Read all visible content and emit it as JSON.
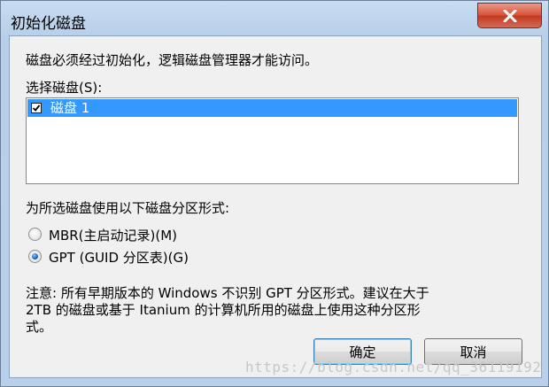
{
  "window": {
    "title": "初始化磁盘",
    "close_icon": "close-icon"
  },
  "dialog": {
    "description": "磁盘必须经过初始化，逻辑磁盘管理器才能访问。",
    "select_label": "选择磁盘(S):",
    "disks": [
      {
        "label": "磁盘 1",
        "checked": true,
        "selected": true
      }
    ],
    "partition_label": "为所选磁盘使用以下磁盘分区形式:",
    "options": [
      {
        "label": "MBR(主启动记录)(M)",
        "selected": false
      },
      {
        "label": "GPT (GUID 分区表)(G)",
        "selected": true
      }
    ],
    "note_line1": "注意: 所有早期版本的 Windows 不识别 GPT 分区形式。建议在大于",
    "note_line2": "2TB 的磁盘或基于 Itanium 的计算机所用的磁盘上使用这种分区形",
    "note_line3": "式。",
    "ok_label": "确定",
    "cancel_label": "取消"
  },
  "watermark": "https://blog.csdn.net/qq_36119192",
  "colors": {
    "selection": "#3399ff",
    "close_button": "#c23a20",
    "title_bar": "#b9d0ea"
  }
}
